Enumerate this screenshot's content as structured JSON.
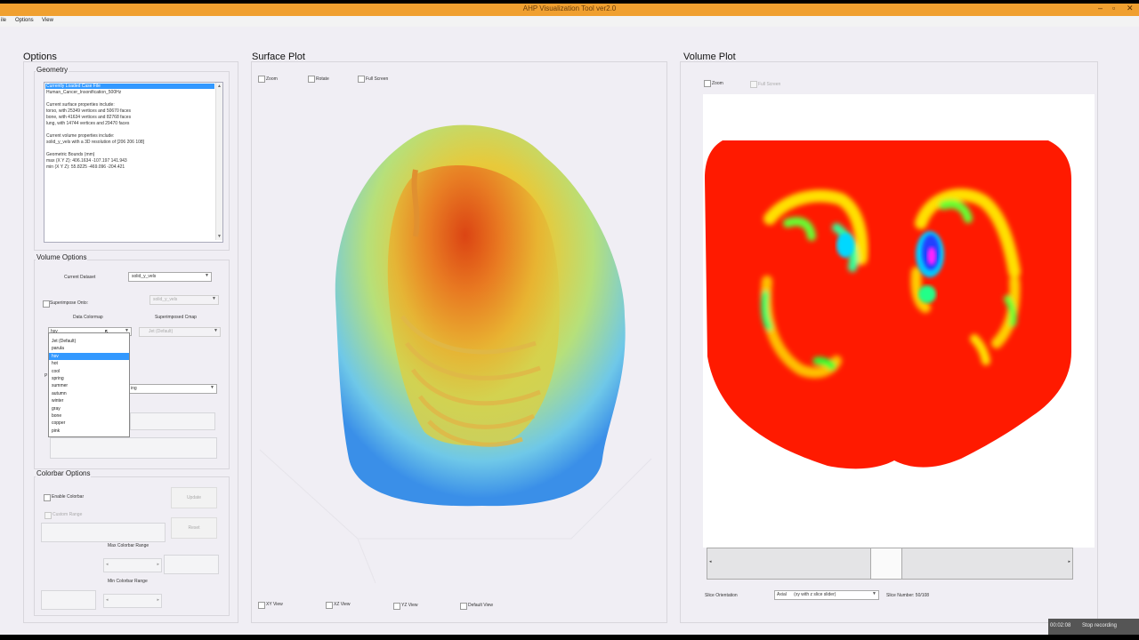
{
  "window": {
    "title": "AHP Visualization Tool ver2.0",
    "menu": [
      "File",
      "Options",
      "View"
    ],
    "menu_display": [
      "ile",
      "Options",
      "View"
    ]
  },
  "options_panel": {
    "title": "Options",
    "geometry": {
      "title": "Geometry",
      "lines": [
        "Currently Loaded Case File",
        "Human_Cancer_Insonification_500Hz",
        "",
        "Current surface properties include:",
        "torso, with  25349 vertices and  50670 faces",
        "bone, with  41634 vertices and  82768 faces",
        "lung, with  14744 vertices and  29470 faces",
        "",
        "Current volume properties include:",
        "solid_y_vels with a 3D resolution of [206  206  108]",
        "",
        "Geometric Bounds (mm)",
        "max (X Y Z): 406.1634    -107.197    141.943",
        "min (X Y Z): 55.8225    -469.096    -204.421"
      ]
    },
    "volume": {
      "title": "Volume Options",
      "current_dataset_label": "Current Dataset",
      "current_dataset_value": "solid_y_vels",
      "superimpose_label": "Superimpose Onto:",
      "superimpose_value": "solid_y_vels",
      "data_colormap_label": "Data Colormap",
      "data_colormap_value": "hsv",
      "superimposed_cmap_label": "Superimposed Cmap",
      "superimposed_cmap_value": "Jet (Default)",
      "extra_select_value": "ing",
      "extra_label": "ssion",
      "partial_p": "P"
    },
    "colormap_options": [
      "Jet (Default)",
      "parula",
      "hsv",
      "hot",
      "cool",
      "spring",
      "summer",
      "autumn",
      "winter",
      "gray",
      "bone",
      "copper",
      "pink"
    ],
    "colormap_highlighted": "hsv",
    "colorbar": {
      "title": "Colorbar Options",
      "enable_label": "Enable Colorbar",
      "custom_range_label": "Custom Range",
      "update_label": "Update",
      "reset_label": "Reset",
      "max_range_label": "Max Colorbar Range",
      "min_range_label": "Min Colorbar Range"
    }
  },
  "surface_plot": {
    "title": "Surface Plot",
    "zoom_label": "Zoom",
    "rotate_label": "Rotate",
    "fullscreen_label": "Full Screen",
    "views": [
      "XY View",
      "XZ View",
      "YZ View",
      "Default View"
    ]
  },
  "volume_plot": {
    "title": "Volume Plot",
    "zoom_label": "Zoom",
    "fullscreen_label": "Full Screen",
    "slice_orientation_label": "Slice Orientation",
    "slice_orientation_value": "Axial      (xy with z slice slider)",
    "slice_number_label": "Slice Number: 50/108"
  },
  "recording": {
    "time": "00:02:08",
    "stop_label": "Stop recording"
  },
  "colors": {
    "titlebar": "#f0a030",
    "highlight": "#3399ff",
    "volume_bg": "#ff1a00"
  }
}
